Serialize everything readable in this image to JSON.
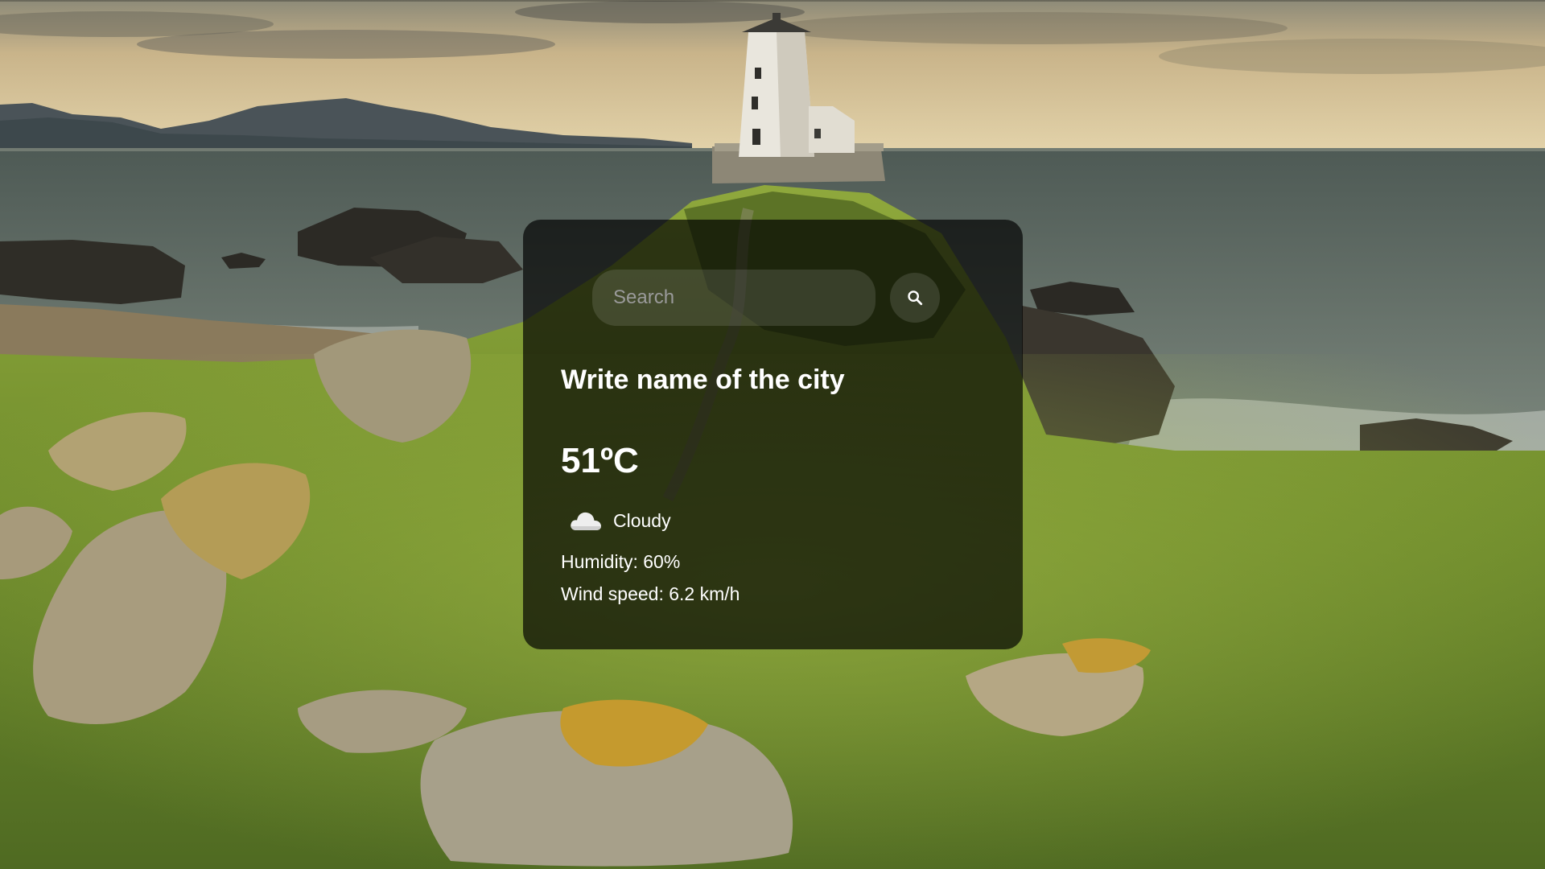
{
  "background": {
    "description_icon": "lighthouse-coast-photo",
    "sky_color": "#c9b48a",
    "sea_color": "#5f6a60",
    "grass_color": "#7f9a33"
  },
  "search": {
    "placeholder": "Search",
    "value": "",
    "button_icon": "search-icon"
  },
  "weather": {
    "city": "Write name of the city",
    "temperature": "51ºC",
    "condition_icon": "cloud-icon",
    "condition": "Cloudy",
    "humidity": "Humidity: 60%",
    "wind": "Wind speed: 6.2 km/h"
  },
  "colors": {
    "card_background": "rgba(0,0,0,0.68)",
    "text": "#ffffff",
    "input_background": "rgba(255,255,255,0.12)"
  }
}
